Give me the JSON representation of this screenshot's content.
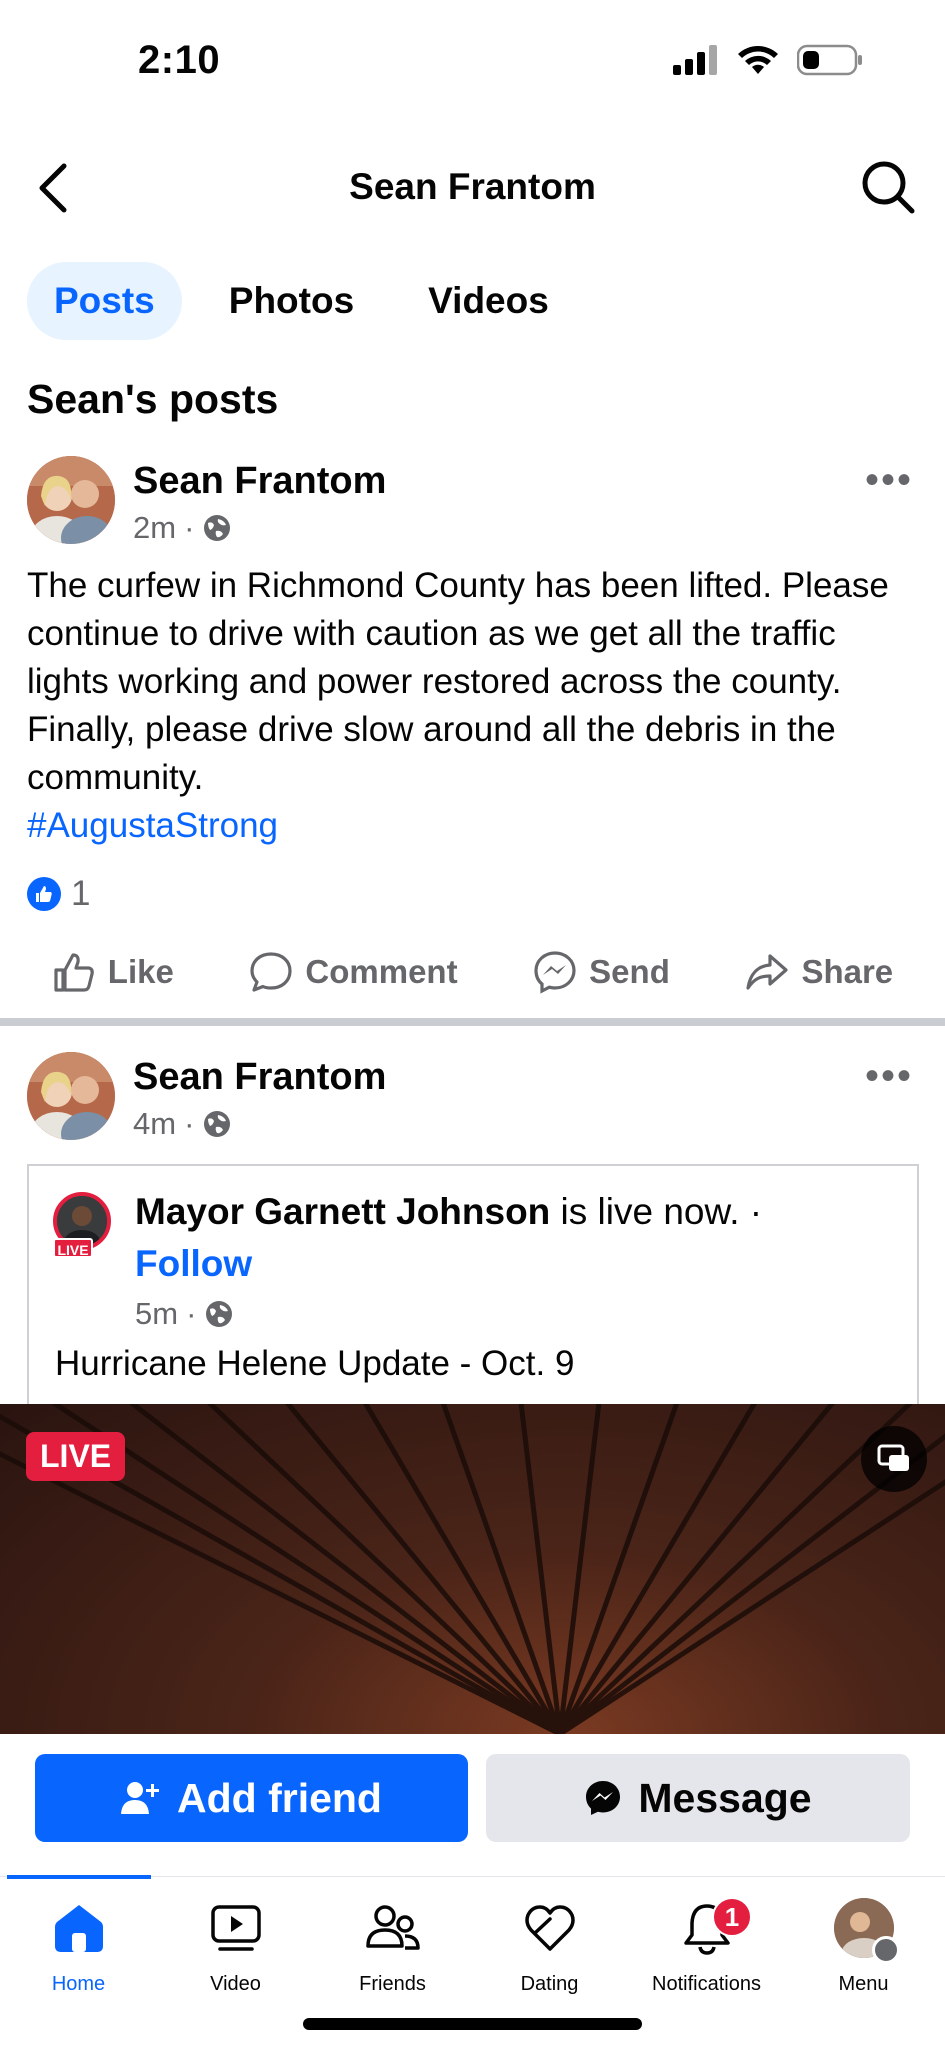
{
  "status": {
    "time": "2:10"
  },
  "header": {
    "title": "Sean Frantom"
  },
  "tabs": [
    {
      "label": "Posts",
      "active": true
    },
    {
      "label": "Photos",
      "active": false
    },
    {
      "label": "Videos",
      "active": false
    }
  ],
  "section_title": "Sean's posts",
  "posts": [
    {
      "author": "Sean Frantom",
      "time": "2m",
      "text": "The curfew in Richmond County has been lifted. Please continue to drive with caution as we get all the traffic lights working and power restored across the county. Finally, please drive slow around all the debris in the community.",
      "hashtag": "#AugustaStrong",
      "like_count": "1"
    },
    {
      "author": "Sean Frantom",
      "time": "4m",
      "shared": {
        "name": "Mayor Garnett Johnson",
        "status": " is live now. ·",
        "follow": "Follow",
        "live_mini": "LIVE",
        "time": "5m",
        "title": "Hurricane Helene Update - Oct. 9",
        "live_badge": "LIVE"
      }
    }
  ],
  "actions": {
    "like": "Like",
    "comment": "Comment",
    "send": "Send",
    "share": "Share"
  },
  "cta": {
    "add_friend": "Add friend",
    "message": "Message"
  },
  "tabbar": {
    "home": "Home",
    "video": "Video",
    "friends": "Friends",
    "dating": "Dating",
    "notifications": "Notifications",
    "notifications_badge": "1",
    "menu": "Menu"
  },
  "colors": {
    "accent": "#0866ff",
    "live": "#e41e3f",
    "muted": "#65676b"
  }
}
